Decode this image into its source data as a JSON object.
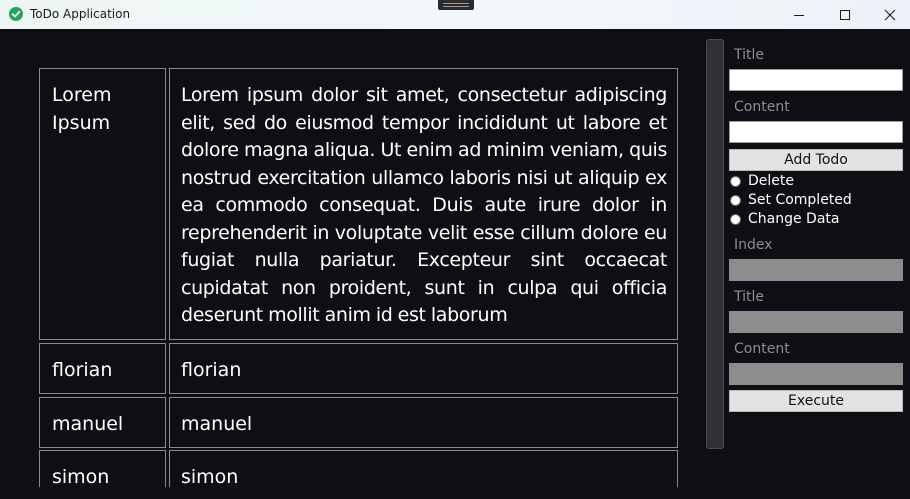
{
  "window": {
    "title": "ToDo Application",
    "app_icon": "check-circle-icon",
    "controls": [
      "minimize-icon",
      "maximize-icon",
      "close-icon"
    ]
  },
  "todos": [
    {
      "title": "Lorem Ipsum",
      "content": "Lorem ipsum dolor sit amet, consectetur adipiscing elit, sed do eiusmod tempor incididunt ut labore et dolore magna aliqua. Ut enim ad minim veniam, quis nostrud exercitation ullamco laboris nisi ut aliquip ex ea commodo consequat. Duis aute irure dolor in reprehenderit in voluptate velit esse cillum dolore eu fugiat nulla pariatur. Excepteur sint occaecat cupidatat non proident, sunt in culpa qui officia deserunt mollit anim id est laborum"
    },
    {
      "title": "florian",
      "content": "florian"
    },
    {
      "title": "manuel",
      "content": "manuel"
    },
    {
      "title": "simon",
      "content": "simon"
    }
  ],
  "add_form": {
    "title_label": "Title",
    "title_value": "",
    "content_label": "Content",
    "content_value": "",
    "add_button": "Add Todo"
  },
  "actions": {
    "options": [
      {
        "label": "Delete",
        "selected": false
      },
      {
        "label": "Set Completed",
        "selected": false
      },
      {
        "label": "Change Data",
        "selected": false
      }
    ]
  },
  "edit_form": {
    "index_label": "Index",
    "index_value": "",
    "title_label": "Title",
    "title_value": "",
    "content_label": "Content",
    "content_value": "",
    "execute_button": "Execute"
  },
  "colors": {
    "background": "#0e0f15",
    "cell_border": "#8a8a8a",
    "label_gray": "#8e8e8e",
    "disabled_input": "#8d8d8d",
    "accent_green": "#23a55a"
  }
}
